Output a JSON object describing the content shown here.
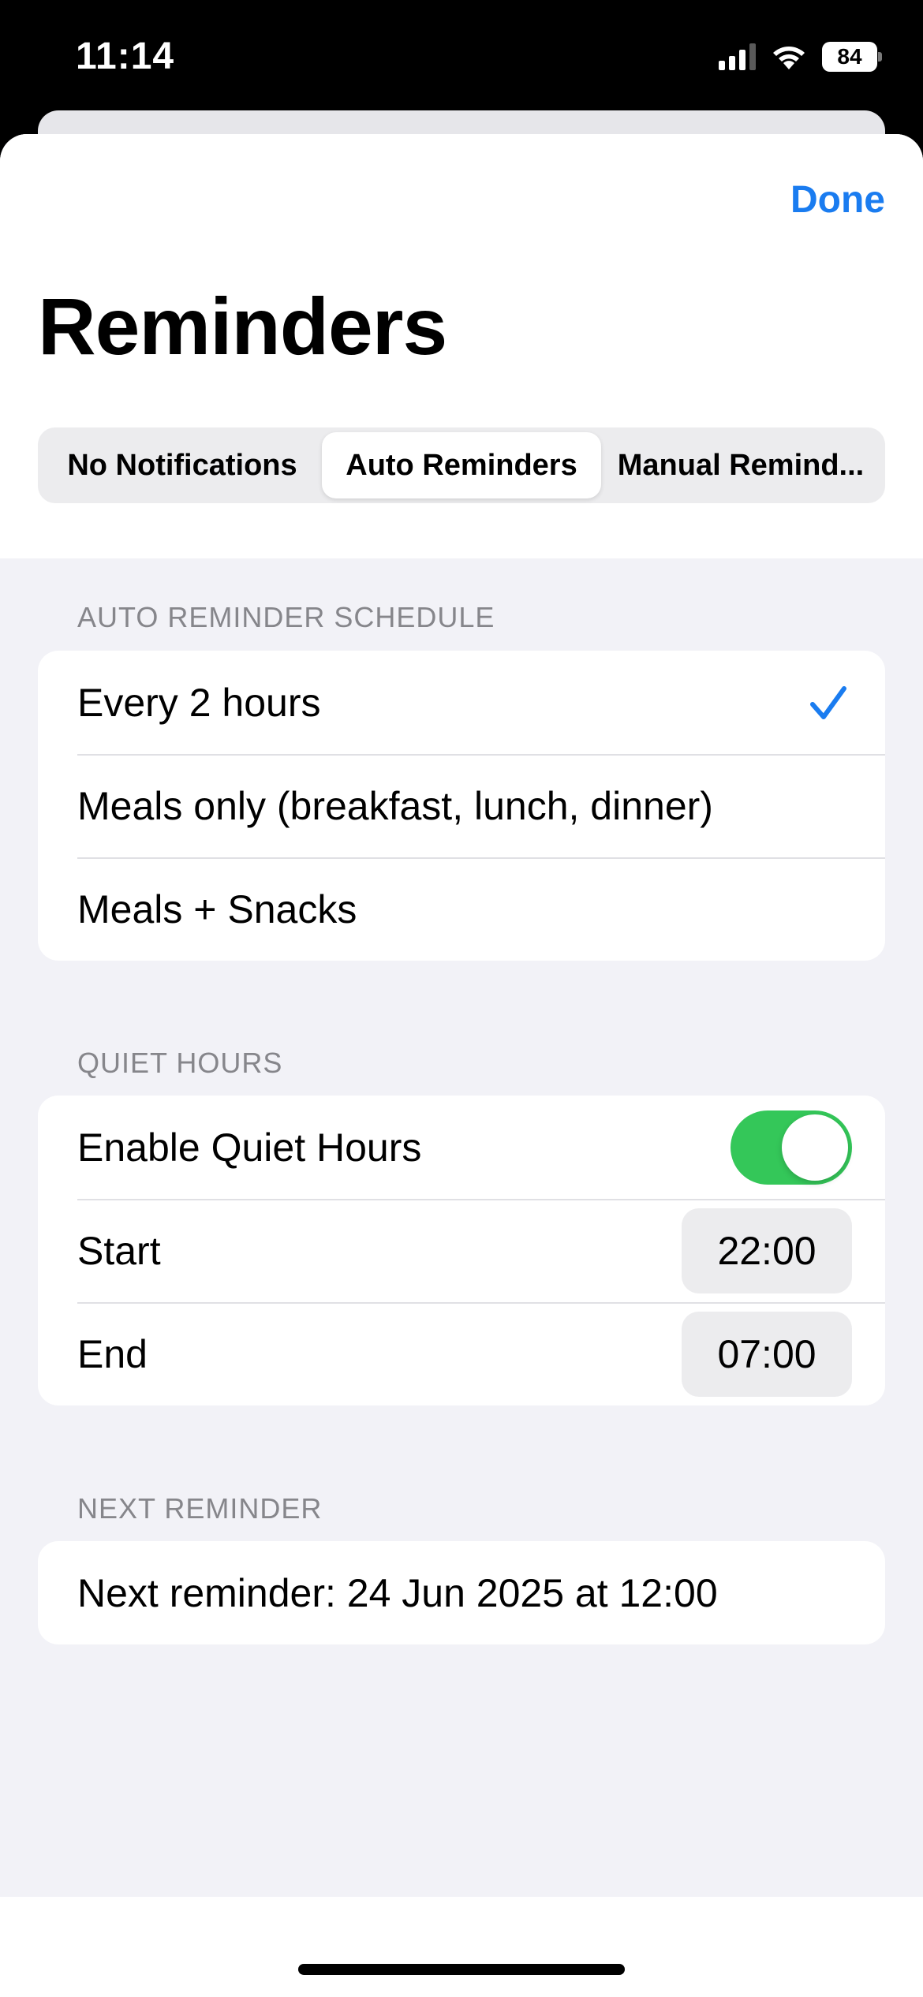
{
  "status_bar": {
    "time": "11:14",
    "battery": "84"
  },
  "header": {
    "done_label": "Done",
    "title": "Reminders"
  },
  "segments": [
    {
      "label": "No Notifications",
      "selected": false
    },
    {
      "label": "Auto Reminders",
      "selected": true
    },
    {
      "label": "Manual Remind...",
      "selected": false
    }
  ],
  "schedule": {
    "header": "AUTO REMINDER SCHEDULE",
    "options": [
      {
        "label": "Every 2 hours",
        "checked": true
      },
      {
        "label": "Meals only (breakfast, lunch, dinner)",
        "checked": false
      },
      {
        "label": "Meals + Snacks",
        "checked": false
      }
    ]
  },
  "quiet_hours": {
    "header": "QUIET HOURS",
    "enable_label": "Enable Quiet Hours",
    "enabled": true,
    "start_label": "Start",
    "start_value": "22:00",
    "end_label": "End",
    "end_value": "07:00"
  },
  "next": {
    "header": "NEXT REMINDER",
    "text": "Next reminder: 24 Jun 2025 at 12:00"
  },
  "colors": {
    "accent": "#1a7cf0",
    "toggle_on": "#34c759"
  }
}
